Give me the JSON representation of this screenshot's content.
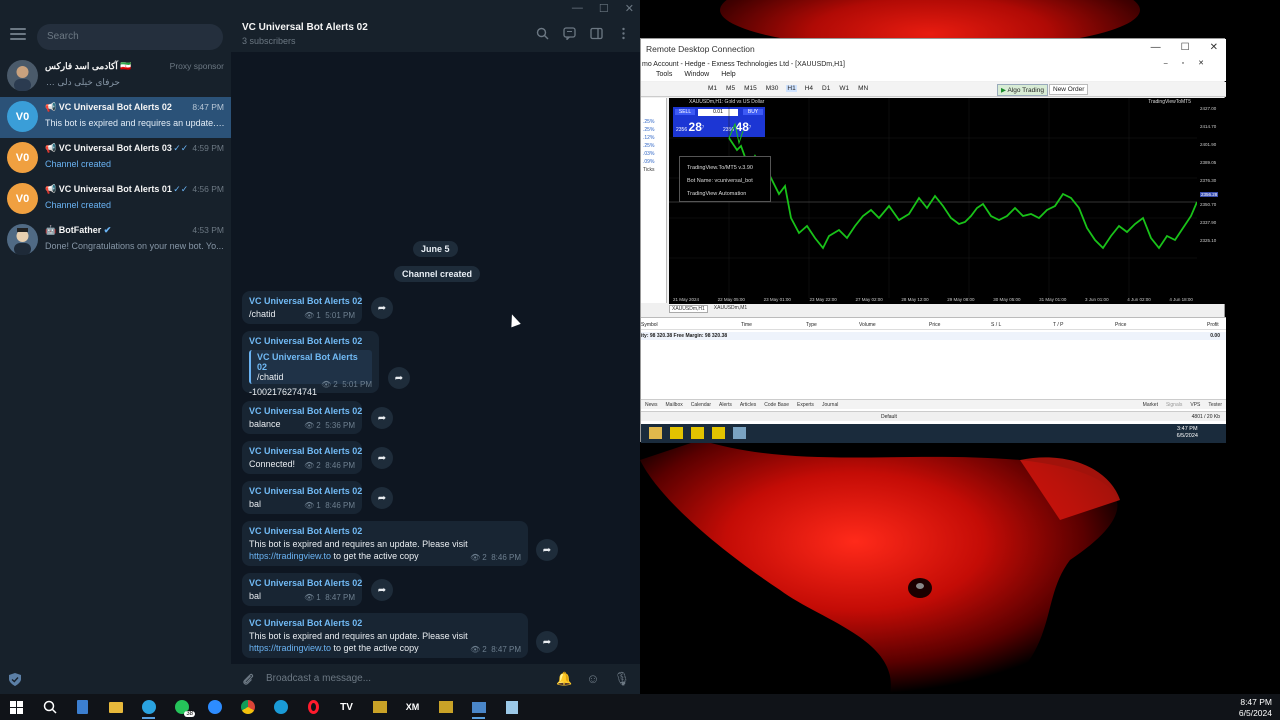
{
  "sidebar": {
    "search_placeholder": "Search",
    "chats": [
      {
        "name": "آکادمی اسد فارکس 🇮🇷",
        "time": "Proxy sponsor",
        "preview": "حرفای خیلی دلی ❤️",
        "avatar": "",
        "color": "#4a5a6a"
      },
      {
        "name": "📢 VC Universal Bot Alerts 02",
        "time": "8:47 PM",
        "preview": "This bot is expired and requires an update. ...",
        "avatar": "V0",
        "color": "#3a9ed8"
      },
      {
        "name": "📢 VC Universal Bot Alerts 03",
        "time": "4:59 PM",
        "preview": "Channel created",
        "avatar": "V0",
        "color": "#f0a040"
      },
      {
        "name": "📢 VC Universal Bot Alerts 01",
        "time": "4:56 PM",
        "preview": "Channel created",
        "avatar": "V0",
        "color": "#f0a040"
      },
      {
        "name": "🤖 BotFather",
        "time": "4:53 PM",
        "preview": "Done! Congratulations on your new bot. Yo...",
        "avatar": "",
        "color": "#506a84"
      }
    ]
  },
  "chat": {
    "title": "VC Universal Bot Alerts 02",
    "subtitle": "3 subscribers",
    "date_label": "June 5",
    "service_label": "Channel created",
    "composer_placeholder": "Broadcast a message...",
    "messages": [
      {
        "author": "VC Universal Bot Alerts 02",
        "text": "/chatid",
        "views": "1",
        "time": "5:01 PM"
      },
      {
        "author": "VC Universal Bot Alerts 02",
        "reply_author": "VC Universal Bot Alerts 02",
        "reply_text": "/chatid",
        "text": "-1002176274741",
        "views": "2",
        "time": "5:01 PM"
      },
      {
        "author": "VC Universal Bot Alerts 02",
        "text": "balance",
        "views": "2",
        "time": "5:36 PM"
      },
      {
        "author": "VC Universal Bot Alerts 02",
        "text": "Connected!",
        "views": "2",
        "time": "8:46 PM"
      },
      {
        "author": "VC Universal Bot Alerts 02",
        "text": "bal",
        "views": "1",
        "time": "8:46 PM"
      },
      {
        "author": "VC Universal Bot Alerts 02",
        "text": "This bot is expired and requires an update. Please visit",
        "link": "https://tradingview.to",
        "text2": " to get the active copy",
        "views": "2",
        "time": "8:46 PM"
      },
      {
        "author": "VC Universal Bot Alerts 02",
        "text": "bal",
        "views": "1",
        "time": "8:47 PM"
      },
      {
        "author": "VC Universal Bot Alerts 02",
        "text": "This bot is expired and requires an update. Please visit",
        "link": "https://tradingview.to",
        "text2": " to get the active copy",
        "views": "2",
        "time": "8:47 PM"
      }
    ]
  },
  "rdp": {
    "title": "Remote Desktop Connection",
    "mt_title": "mo Account - Hedge - Exness Technologies Ltd - [XAUUSDm,H1]",
    "menu": [
      "Tools",
      "Window",
      "Help"
    ],
    "timeframes": [
      "M1",
      "M5",
      "M15",
      "M30",
      "H1",
      "H4",
      "D1",
      "W1",
      "MN"
    ],
    "active_tf": "H1",
    "algo_label": "Algo Trading",
    "new_order_label": "New Order",
    "symbol_header": "XAUUSDm,H1: Gold vs US Dollar",
    "sell_label": "SELL",
    "buy_label": "BUY",
    "lot": "0.01",
    "bid_small": "2356",
    "bid_big": "28",
    "bid_sup": "7",
    "ask_small": "2356",
    "ask_big": "48",
    "ask_sup": "7",
    "indicator_label": "TradingViewToMT5",
    "bot_line1": "TradingView.To/MT5 v.3.90",
    "bot_line2": "Bot Name: vcuniversal_bot",
    "bot_line3": "TradingView Automation",
    "price_levels": [
      "2427.00",
      "2414.70",
      "2401.90",
      "2389.05",
      "2376.30",
      "2363.50",
      "2356.28",
      "2350.70",
      "2337.90",
      "2325.10"
    ],
    "dates": [
      "21 May 2024",
      "21 May 19:00",
      "22 May 05:00",
      "22 May 15:00",
      "23 May 01:00",
      "23 May 11:00",
      "23 May 22:00",
      "24 May 08:00",
      "27 May 02:00",
      "28 May 02:00",
      "28 May 12:00",
      "28 May 22:00",
      "29 May 08:00",
      "29 May 18:00",
      "30 May 05:00",
      "30 May 15:00",
      "31 May 01:00",
      "31 May 11:00",
      "3 Jun 01:00",
      "3 Jun 07:00",
      "4 Jun 02:00",
      "4 Jun 07:00",
      "4 Jun 18:00",
      "5 Jun 05:00"
    ],
    "symbol_tabs": [
      "XAUUSDm,H1",
      "XAUUSDm,M1"
    ],
    "term_cols": [
      "Symbol",
      "Time",
      "Type",
      "Volume",
      "Price",
      "S / L",
      "T / P",
      "Price",
      "Profit"
    ],
    "balance_row": "ity: 98 320.38  Free Margin: 98 320.38",
    "balance_profit": "0.00",
    "bottom_tabs": [
      "News",
      "Mailbox",
      "Calendar",
      "Alerts",
      "Articles",
      "Code Base",
      "Experts",
      "Journal"
    ],
    "right_tabs": [
      "Market",
      "Signals",
      "VPS",
      "Tester"
    ],
    "status_default": "Default",
    "status_traffic": "4801 / 20 Kb",
    "clock_time": "3:47 PM",
    "clock_date": "6/5/2024",
    "nav_items": [
      "Ticks"
    ]
  },
  "taskbar": {
    "time": "8:47 PM",
    "date": "6/5/2024",
    "whatsapp_badge": "38"
  }
}
